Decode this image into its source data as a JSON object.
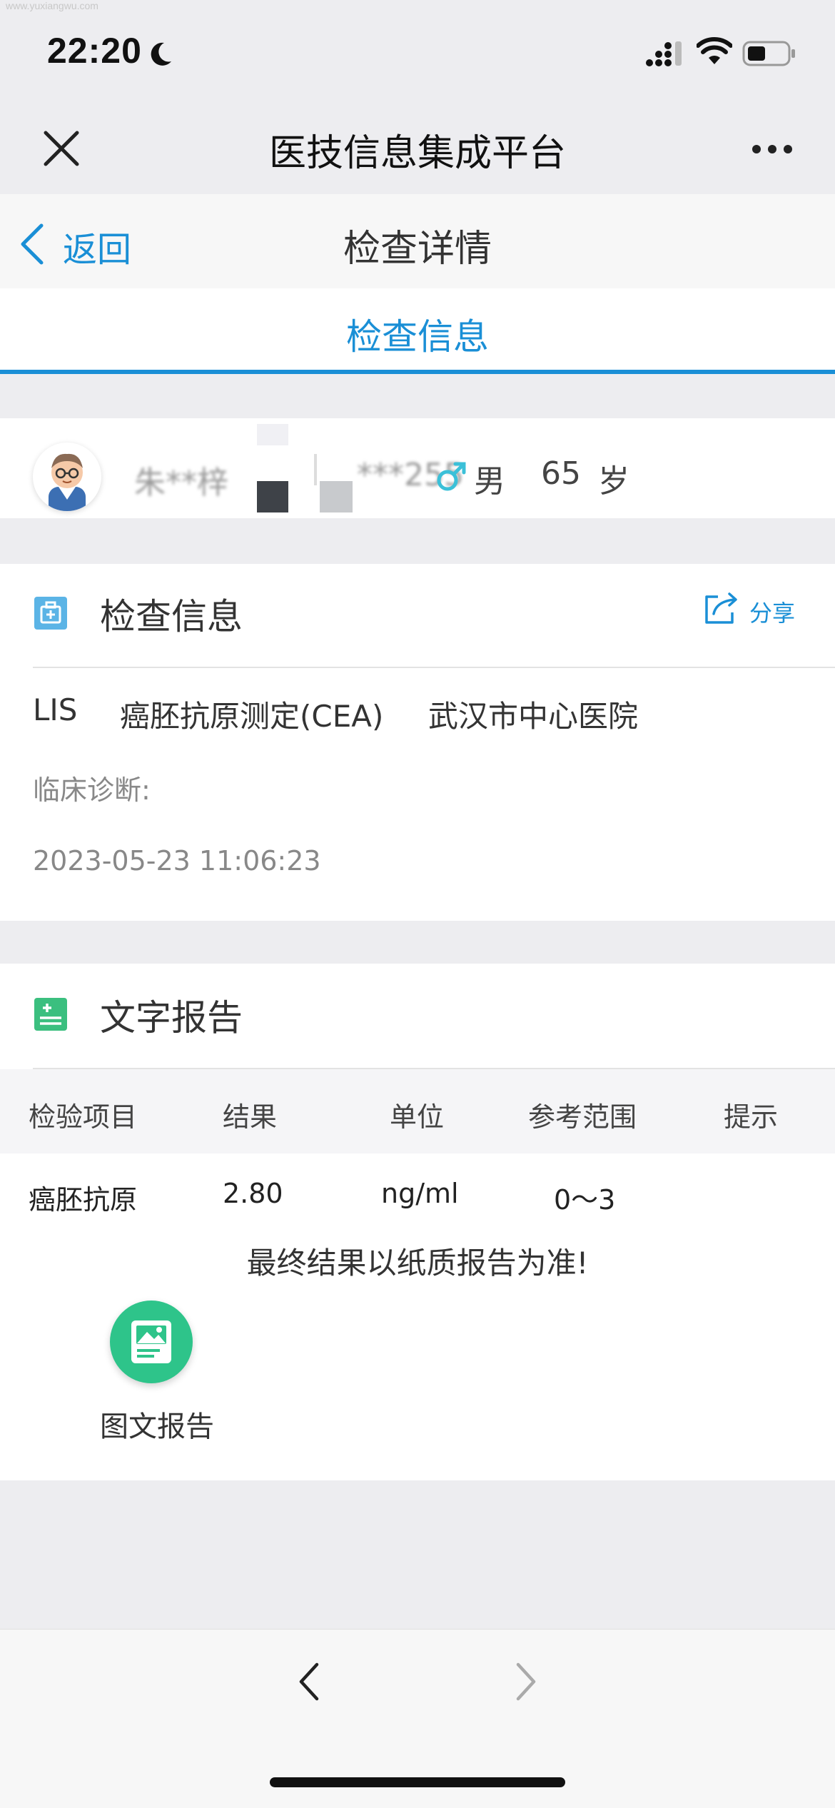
{
  "watermark": "www.yuxiangwu.com",
  "status_bar": {
    "time": "22:20"
  },
  "app": {
    "title": "医技信息集成平台"
  },
  "subheader": {
    "back_label": "返回",
    "title": "检查详情"
  },
  "tab": {
    "label": "检查信息"
  },
  "patient": {
    "name": "朱**梓",
    "id": "***255",
    "gender": "男",
    "age": "65",
    "age_unit": "岁"
  },
  "exam": {
    "title": "检查信息",
    "share_label": "分享",
    "system": "LIS",
    "test_name": "癌胚抗原测定(CEA)",
    "hospital": "武汉市中心医院",
    "diagnosis_label": "临床诊断:",
    "datetime": "2023-05-23 11:06:23"
  },
  "report": {
    "title": "文字报告",
    "columns": [
      "检验项目",
      "结果",
      "单位",
      "参考范围",
      "提示"
    ],
    "rows": [
      {
        "item": "癌胚抗原",
        "result": "2.80",
        "unit": "ng/ml",
        "range": "0～3",
        "hint": ""
      }
    ],
    "notice": "最终结果以纸质报告为准!",
    "image_report_label": "图文报告"
  },
  "colors": {
    "accent": "#1a8fd6",
    "green": "#2ec48a",
    "exam_icon": "#5bb4e6",
    "report_icon": "#3bbf7f"
  }
}
